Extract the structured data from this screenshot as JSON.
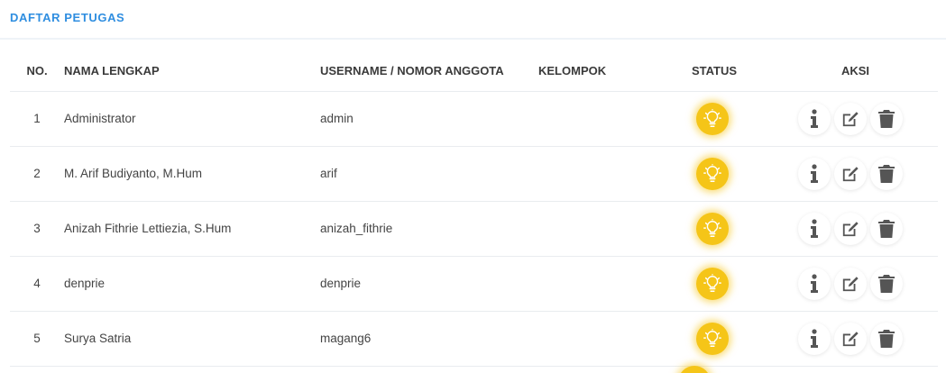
{
  "header": {
    "title": "DAFTAR PETUGAS"
  },
  "table": {
    "columns": {
      "no": "NO.",
      "name": "NAMA LENGKAP",
      "username": "USERNAME / NOMOR ANGGOTA",
      "group": "KELOMPOK",
      "status": "STATUS",
      "actions": "AKSI"
    },
    "rows": [
      {
        "no": "1",
        "name": "Administrator",
        "username": "admin",
        "group": "",
        "status_icon": "lightbulb-icon"
      },
      {
        "no": "2",
        "name": "M. Arif Budiyanto, M.Hum",
        "username": "arif",
        "group": "",
        "status_icon": "lightbulb-icon"
      },
      {
        "no": "3",
        "name": "Anizah Fithrie Lettiezia, S.Hum",
        "username": "anizah_fithrie",
        "group": "",
        "status_icon": "lightbulb-icon"
      },
      {
        "no": "4",
        "name": "denprie",
        "username": "denprie",
        "group": "",
        "status_icon": "lightbulb-icon"
      },
      {
        "no": "5",
        "name": "Surya Satria",
        "username": "magang6",
        "group": "",
        "status_icon": "lightbulb-icon"
      }
    ],
    "action_icons": [
      "info-icon",
      "edit-icon",
      "trash-icon"
    ]
  },
  "colors": {
    "accent": "#2f8ee0",
    "status_active": "#f5c518",
    "icon": "#555555"
  }
}
